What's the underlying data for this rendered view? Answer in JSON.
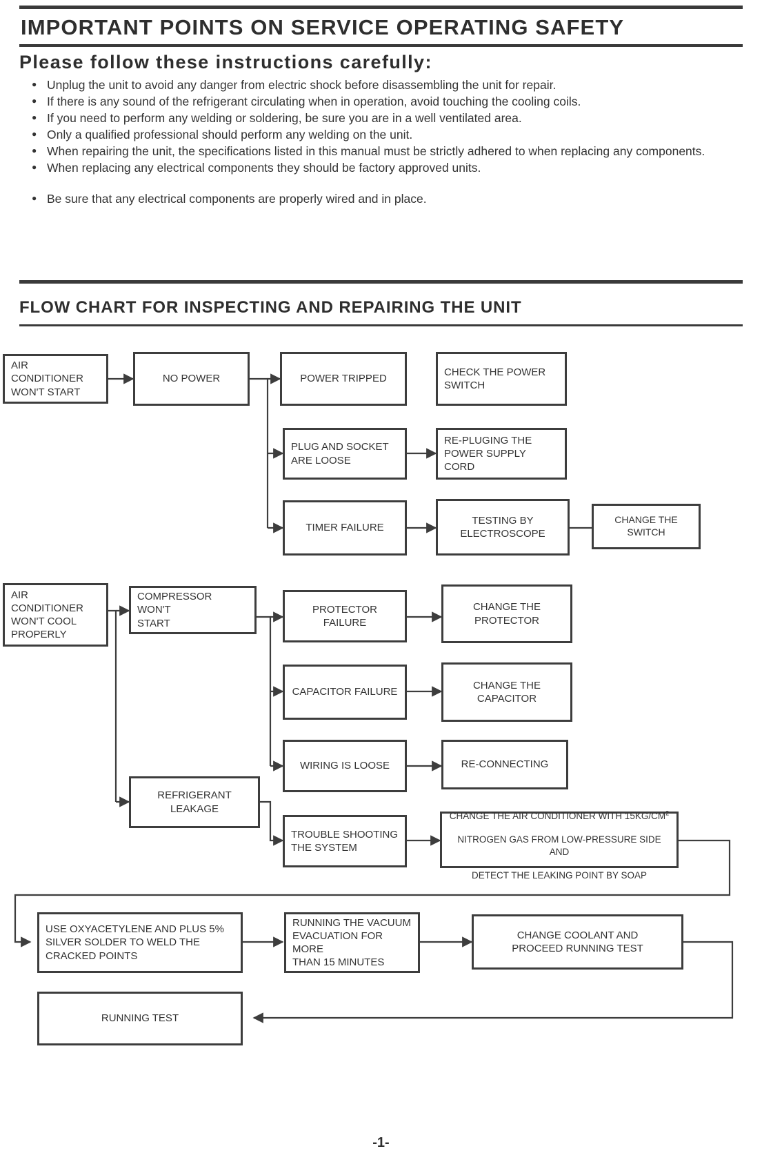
{
  "header": {
    "title": "IMPORTANT POINTS ON SERVICE OPERATING SAFETY",
    "subtitle": "Please follow these instructions carefully:"
  },
  "safety_items": [
    "Unplug the unit to avoid any danger from electric shock before disassembling the unit for repair.",
    "If there is any sound of the refrigerant circulating when in operation, avoid touching the cooling coils.",
    "If you need to perform any welding or soldering, be sure you are in a well ventilated area.",
    "Only a qualified professional should perform any welding on the unit.",
    "When repairing the unit, the specifications listed in this manual must be strictly adhered to when replacing any components.",
    "When replacing any electrical components they should be factory approved units.",
    "Be sure that any electrical components are properly wired and in place."
  ],
  "flow": {
    "title": "FLOW CHART FOR INSPECTING AND REPAIRING THE UNIT",
    "boxes": {
      "ac_wont_start": "AIR CONDITIONER\nWON'T START",
      "no_power": "NO POWER",
      "power_tripped": "POWER TRIPPED",
      "check_power_switch": "CHECK THE POWER\nSWITCH",
      "plug_socket_loose": "PLUG AND SOCKET\nARE LOOSE",
      "re_pluging_cord": "RE-PLUGING THE\nPOWER SUPPLY CORD",
      "timer_failure": "TIMER FAILURE",
      "testing_electroscope": "TESTING BY\nELECTROSCOPE",
      "change_switch": "CHANGE THE SWITCH",
      "ac_wont_cool": "AIR CONDITIONER\nWON'T COOL\nPROPERLY",
      "compressor_wont_start": "COMPRESSOR WON'T\nSTART",
      "protector_failure": "PROTECTOR FAILURE",
      "change_protector": "CHANGE THE\nPROTECTOR",
      "capacitor_failure": "CAPACITOR FAILURE",
      "change_capacitor": "CHANGE THE\nCAPACITOR",
      "wiring_loose": "WIRING IS LOOSE",
      "re_connecting": "RE-CONNECTING",
      "refrigerant_leakage": "REFRIGERANT\nLEAKAGE",
      "trouble_shooting": "TROUBLE SHOOTING\nTHE SYSTEM",
      "nitrogen_line1_a": "CHANGE THE AIR CONDITIONER WITH 15KG/CM",
      "nitrogen_line1_sup": "2",
      "nitrogen_line2": "NITROGEN GAS FROM LOW-PRESSURE SIDE AND",
      "nitrogen_line3": "DETECT THE LEAKING POINT BY SOAP",
      "oxyacetylene": "USE OXYACETYLENE AND PLUS 5%\nSILVER SOLDER TO WELD THE\nCRACKED POINTS",
      "vacuum_evacuation": "RUNNING THE VACUUM\nEVACUATION FOR MORE\nTHAN 15 MINUTES",
      "change_coolant": "CHANGE  COOLANT  AND\nPROCEED RUNNING TEST",
      "running_test": "RUNNING TEST"
    }
  },
  "footer": {
    "page_number": "-1-"
  }
}
